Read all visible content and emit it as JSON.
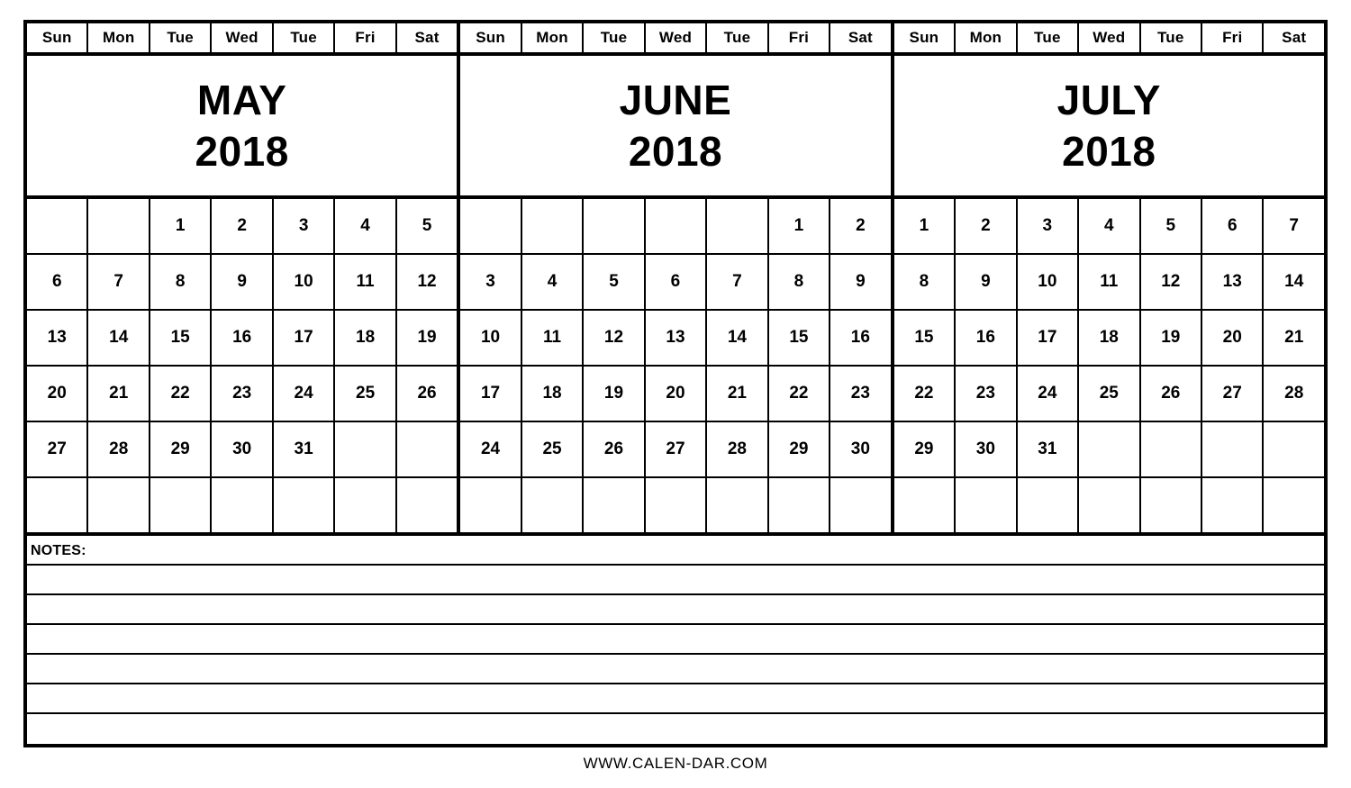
{
  "calendar": {
    "weekday_headers": [
      "Sun",
      "Mon",
      "Tue",
      "Wed",
      "Tue",
      "Fri",
      "Sat"
    ],
    "months": [
      {
        "name": "MAY",
        "year": "2018",
        "weeks": [
          [
            "",
            "",
            "1",
            "2",
            "3",
            "4",
            "5"
          ],
          [
            "6",
            "7",
            "8",
            "9",
            "10",
            "11",
            "12"
          ],
          [
            "13",
            "14",
            "15",
            "16",
            "17",
            "18",
            "19"
          ],
          [
            "20",
            "21",
            "22",
            "23",
            "24",
            "25",
            "26"
          ],
          [
            "27",
            "28",
            "29",
            "30",
            "31",
            "",
            ""
          ],
          [
            "",
            "",
            "",
            "",
            "",
            "",
            ""
          ]
        ]
      },
      {
        "name": "JUNE",
        "year": "2018",
        "weeks": [
          [
            "",
            "",
            "",
            "",
            "",
            "1",
            "2"
          ],
          [
            "3",
            "4",
            "5",
            "6",
            "7",
            "8",
            "9"
          ],
          [
            "10",
            "11",
            "12",
            "13",
            "14",
            "15",
            "16"
          ],
          [
            "17",
            "18",
            "19",
            "20",
            "21",
            "22",
            "23"
          ],
          [
            "24",
            "25",
            "26",
            "27",
            "28",
            "29",
            "30"
          ],
          [
            "",
            "",
            "",
            "",
            "",
            "",
            ""
          ]
        ]
      },
      {
        "name": "JULY",
        "year": "2018",
        "weeks": [
          [
            "1",
            "2",
            "3",
            "4",
            "5",
            "6",
            "7"
          ],
          [
            "8",
            "9",
            "10",
            "11",
            "12",
            "13",
            "14"
          ],
          [
            "15",
            "16",
            "17",
            "18",
            "19",
            "20",
            "21"
          ],
          [
            "22",
            "23",
            "24",
            "25",
            "26",
            "27",
            "28"
          ],
          [
            "29",
            "30",
            "31",
            "",
            "",
            "",
            ""
          ],
          [
            "",
            "",
            "",
            "",
            "",
            "",
            ""
          ]
        ]
      }
    ]
  },
  "notes": {
    "label": "NOTES:",
    "line_count": 7
  },
  "footer": {
    "text": "WWW.CALEN-DAR.COM"
  },
  "colors": {
    "ink": "#000000",
    "paper": "#ffffff"
  }
}
